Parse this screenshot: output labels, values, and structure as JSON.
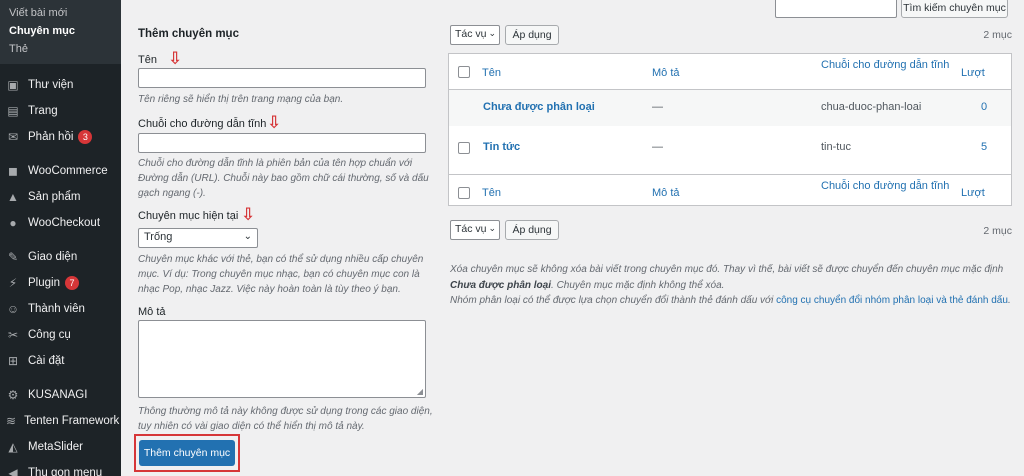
{
  "sidebar": {
    "submenu": [
      {
        "label": "Viết bài mới",
        "current": false
      },
      {
        "label": "Chuyên mục",
        "current": true
      },
      {
        "label": "Thẻ",
        "current": false
      }
    ],
    "items": [
      {
        "label": "Thư viện",
        "icon": "media-icon"
      },
      {
        "label": "Trang",
        "icon": "page-icon"
      },
      {
        "label": "Phản hồi",
        "icon": "comments-icon",
        "badge": "3"
      },
      {
        "label": "WooCommerce",
        "icon": "woocommerce-icon"
      },
      {
        "label": "Sản phẩm",
        "icon": "products-icon"
      },
      {
        "label": "WooCheckout",
        "icon": "checkout-icon"
      },
      {
        "label": "Giao diện",
        "icon": "appearance-icon"
      },
      {
        "label": "Plugin",
        "icon": "plugin-icon",
        "badge": "7"
      },
      {
        "label": "Thành viên",
        "icon": "users-icon"
      },
      {
        "label": "Công cụ",
        "icon": "tools-icon"
      },
      {
        "label": "Cài đặt",
        "icon": "settings-icon"
      },
      {
        "label": "KUSANAGI",
        "icon": "kusanagi-icon"
      },
      {
        "label": "Tenten Framework",
        "icon": "tenten-icon"
      },
      {
        "label": "MetaSlider",
        "icon": "metaslider-icon"
      },
      {
        "label": "Thu gọn menu",
        "icon": "collapse-icon"
      }
    ]
  },
  "form": {
    "title": "Thêm chuyên mục",
    "name_label": "Tên",
    "name_help": "Tên riêng sẽ hiển thị trên trang mạng của bạn.",
    "slug_label": "Chuỗi cho đường dẫn tĩnh",
    "slug_help": "Chuỗi cho đường dẫn tĩnh là phiên bản của tên hợp chuẩn với Đường dẫn (URL). Chuỗi này bao gồm chữ cái thường, số và dấu gạch ngang (-).",
    "parent_label": "Chuyên mục hiện tại",
    "parent_value": "Trống",
    "parent_help": "Chuyên mục khác với thẻ, bạn có thể sử dụng nhiều cấp chuyên mục. Ví dụ: Trong chuyên mục nhạc, bạn có chuyên mục con là nhạc Pop, nhạc Jazz. Việc này hoàn toàn là tùy theo ý bạn.",
    "desc_label": "Mô tả",
    "desc_help": "Thông thường mô tả này không được sử dụng trong các giao diện, tuy nhiên có vài giao diện có thể hiển thị mô tả này.",
    "submit_label": "Thêm chuyên mục"
  },
  "search": {
    "button_label": "Tìm kiếm chuyên mục"
  },
  "bulk": {
    "action_label": "Tác vụ",
    "apply_label": "Áp dụng",
    "count_label": "2 mục"
  },
  "table": {
    "headers": {
      "name": "Tên",
      "description": "Mô tả",
      "slug": "Chuỗi cho đường dẫn tĩnh",
      "count": "Lượt"
    },
    "rows": [
      {
        "name": "Chưa được phân loại",
        "description": "—",
        "slug": "chua-duoc-phan-loai",
        "count": "0"
      },
      {
        "name": "Tin tức",
        "description": "—",
        "slug": "tin-tuc",
        "count": "5"
      }
    ]
  },
  "notes": {
    "delete_note_1": "Xóa chuyên mục sẽ không xóa bài viết trong chuyên mục đó. Thay vì thế, bài viết sẽ được chuyển đến chuyên mục mặc định",
    "delete_note_bold": "Chưa được phân loại",
    "delete_note_2": ". Chuyên mục mặc định không thể xóa.",
    "convert_note": "Nhóm phân loại có thể được lựa chọn chuyển đổi thành thẻ đánh dấu với",
    "convert_link": "công cụ chuyển đổi nhóm phân loại và thẻ đánh dấu",
    "convert_end": "."
  },
  "colors": {
    "accent": "#2271b1",
    "sidebar": "#1d2327",
    "highlight": "#d63638"
  }
}
